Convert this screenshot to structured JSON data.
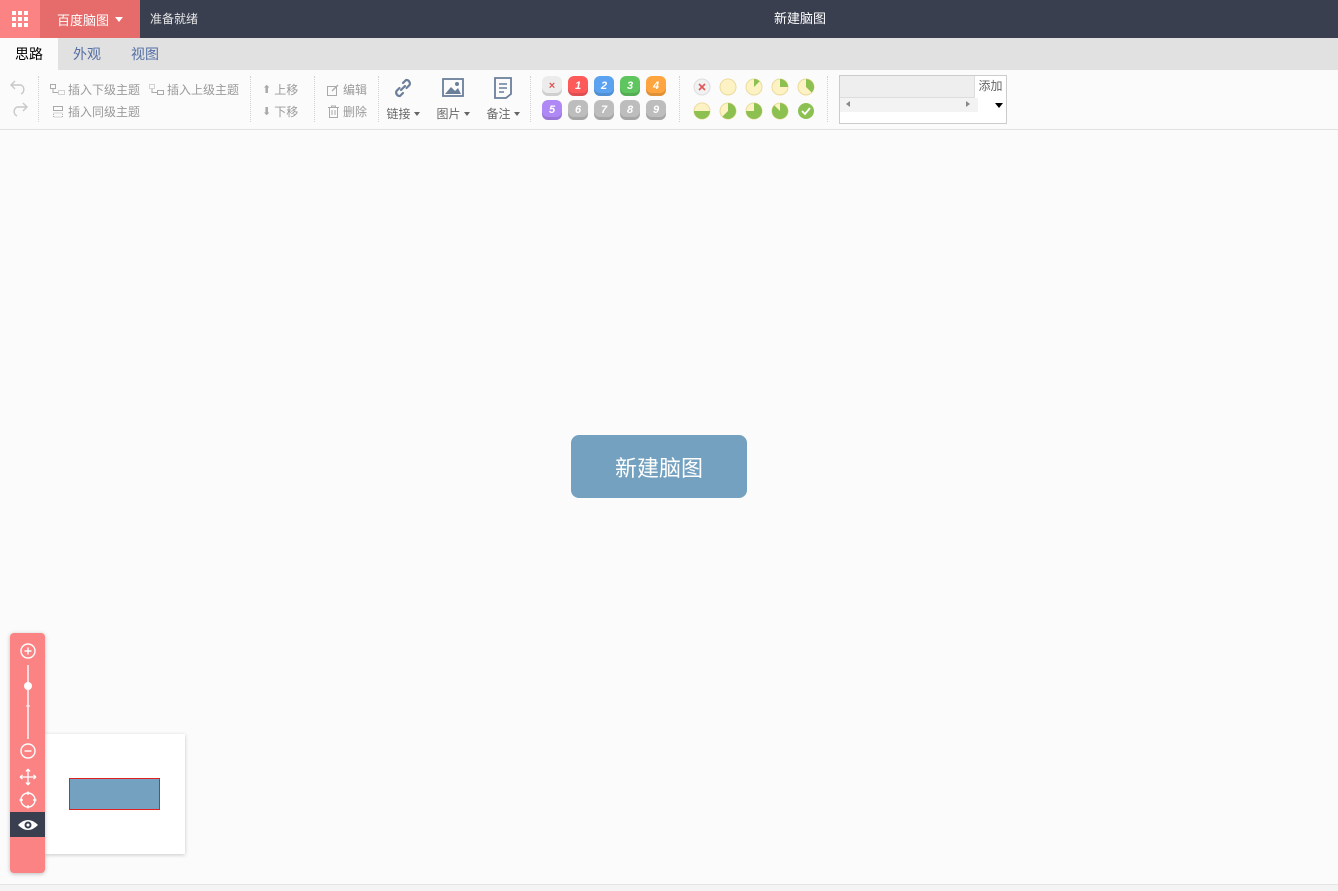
{
  "app": {
    "brand": "百度脑图",
    "status": "准备就绪",
    "title": "新建脑图"
  },
  "tabs": [
    "思路",
    "外观",
    "视图"
  ],
  "toolbar": {
    "insert_child": "插入下级主题",
    "insert_parent": "插入上级主题",
    "insert_sibling": "插入同级主题",
    "move_up": "上移",
    "move_down": "下移",
    "edit": "编辑",
    "delete": "删除",
    "link": "链接",
    "image": "图片",
    "note": "备注",
    "priorities": [
      "×",
      "1",
      "2",
      "3",
      "4",
      "5",
      "6",
      "7",
      "8",
      "9"
    ],
    "priority_colors": [
      "#f1f1f1",
      "#ff5a5a",
      "#5ba3f0",
      "#5fc65f",
      "#ffa53f",
      "#b088f5",
      "#bdbdbd",
      "#bdbdbd",
      "#bdbdbd",
      "#bdbdbd"
    ],
    "progress": [
      "clear",
      "0",
      "1/8",
      "2/8",
      "3/8",
      "4/8",
      "5/8",
      "6/8",
      "7/8",
      "done"
    ],
    "resource_add": "添加"
  },
  "canvas": {
    "root_topic": "新建脑图"
  },
  "colors": {
    "header_bg": "#393f4f",
    "brand_bg": "#e66b6b",
    "accent": "#fc8383",
    "topic": "#73a1bf"
  }
}
